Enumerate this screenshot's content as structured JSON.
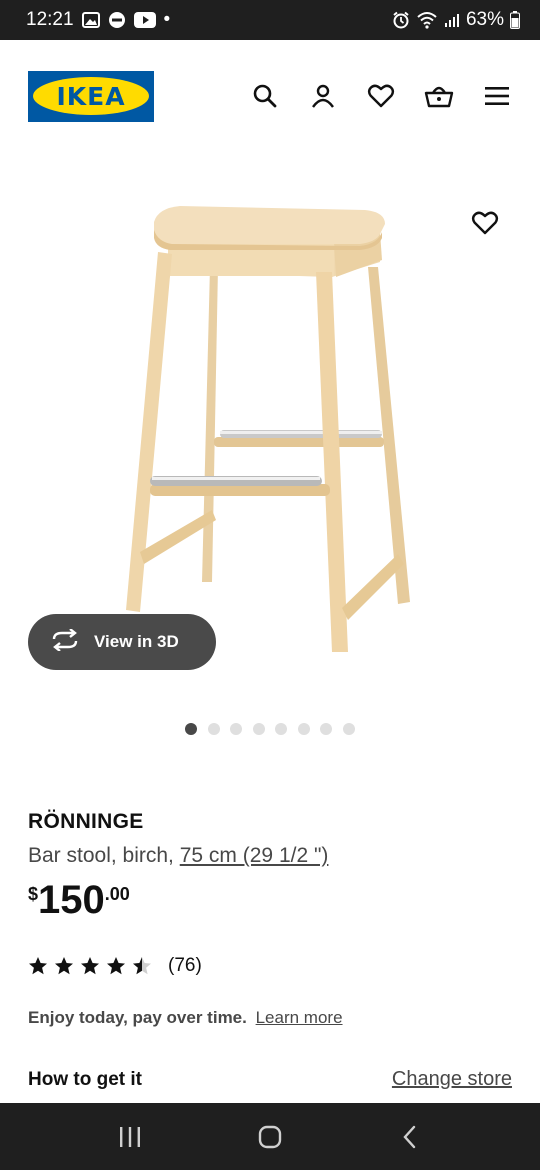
{
  "status_bar": {
    "time": "12:21",
    "dot": "•",
    "battery": "63%"
  },
  "header": {
    "logo_text": "IKEA",
    "icons": [
      "search-icon",
      "account-icon",
      "heart-icon",
      "cart-icon",
      "menu-icon"
    ]
  },
  "gallery": {
    "view_3d_label": "View in 3D",
    "dot_count": 8,
    "active_index": 0
  },
  "product": {
    "name": "RÖNNINGE",
    "description_prefix": "Bar stool, birch, ",
    "size_link": "75 cm (29 1/2 \")",
    "currency": "$",
    "price_int": "150",
    "price_dec": ".00",
    "rating": 4.5,
    "review_count": "(76)"
  },
  "financing": {
    "text": "Enjoy today, pay over time.",
    "link": "Learn more"
  },
  "delivery": {
    "title": "How to get it",
    "change_store": "Change store"
  },
  "colors": {
    "ikea_blue": "#0058a3",
    "ikea_yellow": "#ffdb00"
  }
}
